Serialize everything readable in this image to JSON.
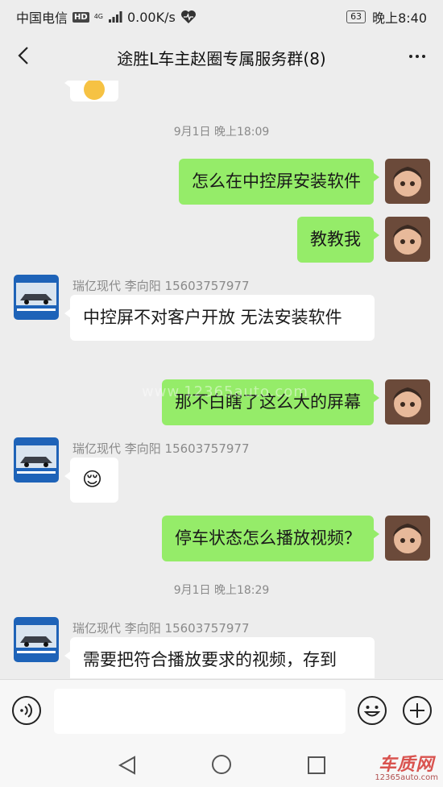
{
  "status_bar": {
    "carrier": "中国电信",
    "hd_badge": "HD",
    "network": "4G",
    "speed": "0.00K/s",
    "battery": "63",
    "time": "晚上8:40"
  },
  "header": {
    "title": "途胜L车主赵圈专属服务群(8)",
    "back_icon": "chevron-left-icon",
    "more_icon": "more-dots-icon"
  },
  "chat": {
    "timestamp_1": "9月1日 晚上18:09",
    "timestamp_2": "9月1日 晚上18:29",
    "sender_name": "瑞亿现代 李向阳 15603757977",
    "messages": [
      {
        "from": "me",
        "text": "怎么在中控屏安装软件"
      },
      {
        "from": "me",
        "text": "教教我"
      },
      {
        "from": "them",
        "text": "中控屏不对客户开放  无法安装软件"
      },
      {
        "from": "me",
        "text": "那不白瞎了这么大的屏幕"
      },
      {
        "from": "them",
        "text": "😌"
      },
      {
        "from": "me",
        "text": "停车状态怎么播放视频？"
      },
      {
        "from": "them",
        "text": "需要把符合播放要求的视频，存到"
      }
    ],
    "watermark": "www.12365auto.com"
  },
  "input_bar": {
    "placeholder": "",
    "voice_icon": "voice-icon",
    "emoji_icon": "emoji-icon",
    "plus_icon": "plus-icon"
  },
  "footer_logo": {
    "main": "车质网",
    "sub": "12365auto.com"
  }
}
